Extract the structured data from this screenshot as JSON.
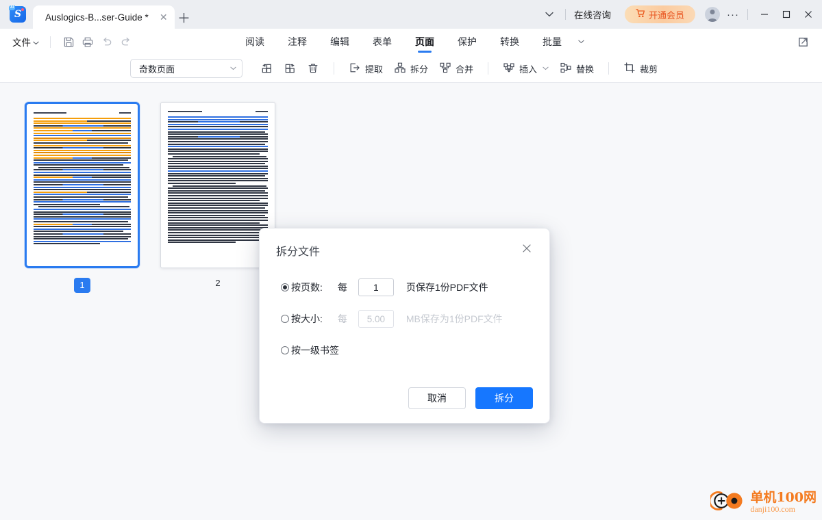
{
  "window": {
    "tab": {
      "title": "Auslogics-B...ser-Guide *",
      "close_icon": "close-icon",
      "add_icon": "plus-icon"
    },
    "logo": {
      "name": "app-logo",
      "mark": "S",
      "badge": "AI"
    },
    "chevron_icon": "chevron-down-icon",
    "consult_label": "在线咨询",
    "vip": {
      "label": "开通会员",
      "icon": "cart-icon",
      "color": "#e8541f"
    },
    "avatar": "avatar-icon",
    "more_icon": "more-dots-icon",
    "controls": {
      "minimize": "—",
      "maximize": "▢",
      "close": "✕"
    }
  },
  "menubar": {
    "file_label": "文件",
    "file_chevron": "chevron-down-icon",
    "quick_icons": [
      "save-icon",
      "print-icon",
      "undo-icon",
      "redo-icon"
    ],
    "tabs": [
      {
        "label": "阅读",
        "active": false
      },
      {
        "label": "注释",
        "active": false
      },
      {
        "label": "编辑",
        "active": false
      },
      {
        "label": "表单",
        "active": false
      },
      {
        "label": "页面",
        "active": true
      },
      {
        "label": "保护",
        "active": false
      },
      {
        "label": "转换",
        "active": false
      },
      {
        "label": "批量",
        "active": false
      }
    ],
    "overflow_icon": "chevron-down-icon",
    "share_icon": "external-link-icon"
  },
  "toolbar": {
    "page_filter": {
      "value": "奇数页面",
      "chevron": "chevron-down-icon"
    },
    "rotate_left_icon": "rotate-left-icon",
    "rotate_right_icon": "rotate-right-icon",
    "delete_icon": "trash-icon",
    "items": [
      {
        "label": "提取",
        "icon": "extract-icon",
        "has_chevron": false
      },
      {
        "label": "拆分",
        "icon": "split-icon",
        "has_chevron": false
      },
      {
        "label": "合并",
        "icon": "merge-icon",
        "has_chevron": false
      },
      {
        "label": "插入",
        "icon": "insert-icon",
        "has_chevron": true
      },
      {
        "label": "替换",
        "icon": "replace-icon",
        "has_chevron": false
      },
      {
        "label": "裁剪",
        "icon": "crop-icon",
        "has_chevron": false
      }
    ]
  },
  "pages": [
    {
      "number": "1",
      "selected": true
    },
    {
      "number": "2",
      "selected": false
    }
  ],
  "dialog": {
    "title": "拆分文件",
    "close_icon": "close-icon",
    "options": [
      {
        "id": "by-pages",
        "checked": true,
        "label": "按页数:",
        "prefix": "每",
        "value": "1",
        "suffix": "页保存1份PDF文件",
        "disabled": false
      },
      {
        "id": "by-size",
        "checked": false,
        "label": "按大小:",
        "prefix": "每",
        "value": "5.00",
        "suffix": "MB保存为1份PDF文件",
        "disabled": true
      },
      {
        "id": "by-bookmark",
        "checked": false,
        "label": "按一级书签",
        "prefix": "",
        "value": "",
        "suffix": "",
        "disabled": false
      }
    ],
    "cancel_label": "取消",
    "confirm_label": "拆分",
    "accent_color": "#1677ff"
  },
  "watermark": {
    "cn": "单机100网",
    "en": "danji100.com",
    "color": "#f47b20"
  }
}
